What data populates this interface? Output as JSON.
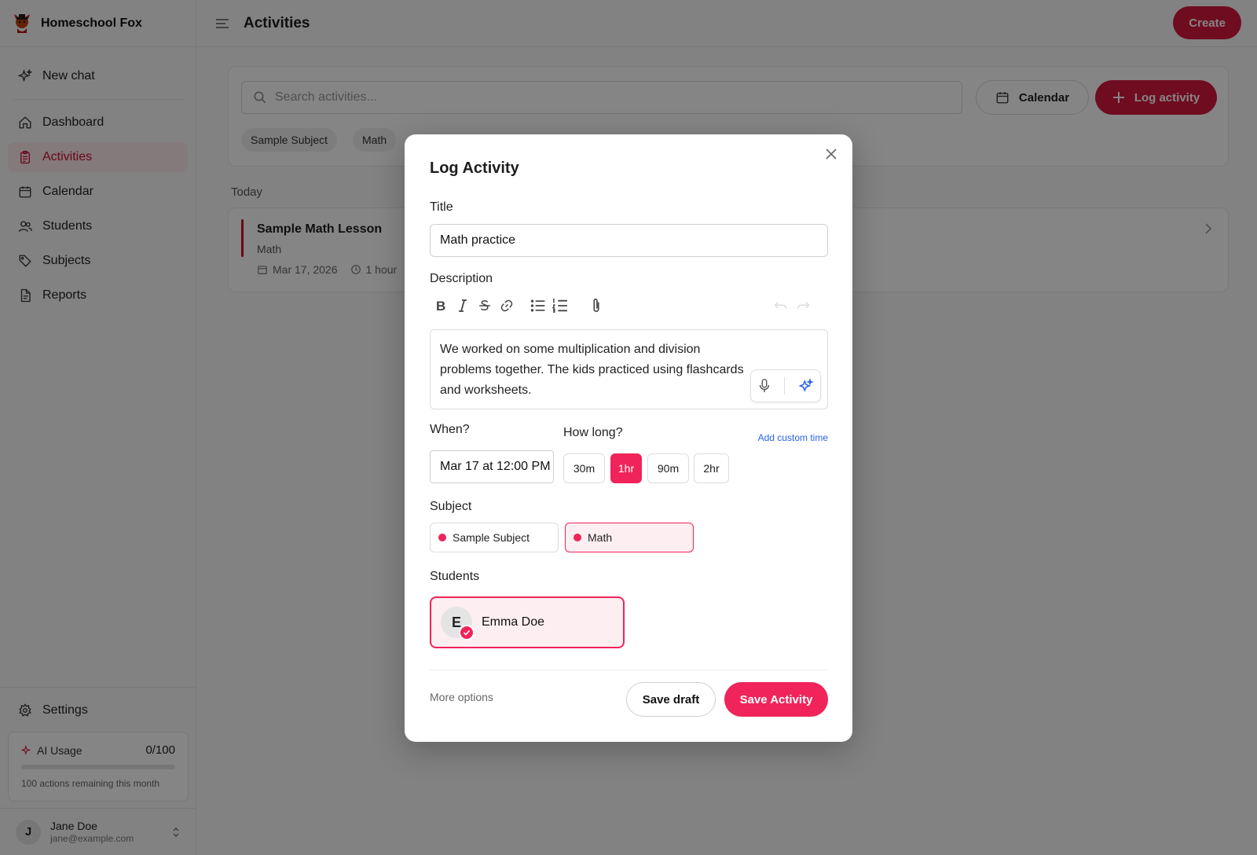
{
  "app": {
    "name": "Homeschool Fox"
  },
  "sidebar": {
    "new_chat": "New chat",
    "items": [
      {
        "label": "Dashboard",
        "icon": "home-icon"
      },
      {
        "label": "Activities",
        "icon": "clipboard-icon",
        "active": true
      },
      {
        "label": "Calendar",
        "icon": "calendar-icon"
      },
      {
        "label": "Students",
        "icon": "users-icon"
      },
      {
        "label": "Subjects",
        "icon": "tag-icon"
      },
      {
        "label": "Reports",
        "icon": "report-icon"
      }
    ],
    "settings": "Settings",
    "usage": {
      "label": "AI Usage",
      "count": "0/100",
      "fraction": 0,
      "note": "100 actions remaining this month"
    },
    "user": {
      "initial": "J",
      "name": "Jane Doe",
      "email": "jane@example.com"
    }
  },
  "header": {
    "title": "Activities",
    "create": "Create"
  },
  "filters": {
    "search_placeholder": "Search activities...",
    "calendar": "Calendar",
    "log_activity": "Log activity",
    "chips": [
      "Sample Subject",
      "Math"
    ]
  },
  "list": {
    "group": "Today",
    "items": [
      {
        "title": "Sample Math Lesson",
        "subject": "Math",
        "date": "Mar 17, 2026",
        "duration": "1 hour"
      }
    ]
  },
  "modal": {
    "title": "Log Activity",
    "title_label": "Title",
    "title_value": "Math practice",
    "description_label": "Description",
    "description_value": "We worked on some multiplication and division problems together. The kids practiced using flashcards and worksheets.",
    "when_label": "When?",
    "when_value": "Mar 17 at 12:00 PM",
    "how_long_label": "How long?",
    "add_custom_time": "Add custom time",
    "durations": [
      "30m",
      "1hr",
      "90m",
      "2hr"
    ],
    "selected_duration": "1hr",
    "subject_label": "Subject",
    "subjects": [
      "Sample Subject",
      "Math"
    ],
    "selected_subject": "Math",
    "students_label": "Students",
    "student": {
      "initial": "E",
      "name": "Emma Doe"
    },
    "more_options": "More options",
    "save_draft": "Save draft",
    "save_activity": "Save Activity"
  },
  "colors": {
    "brand": "#d6183f",
    "accent": "#f0245a",
    "link": "#2563eb"
  }
}
